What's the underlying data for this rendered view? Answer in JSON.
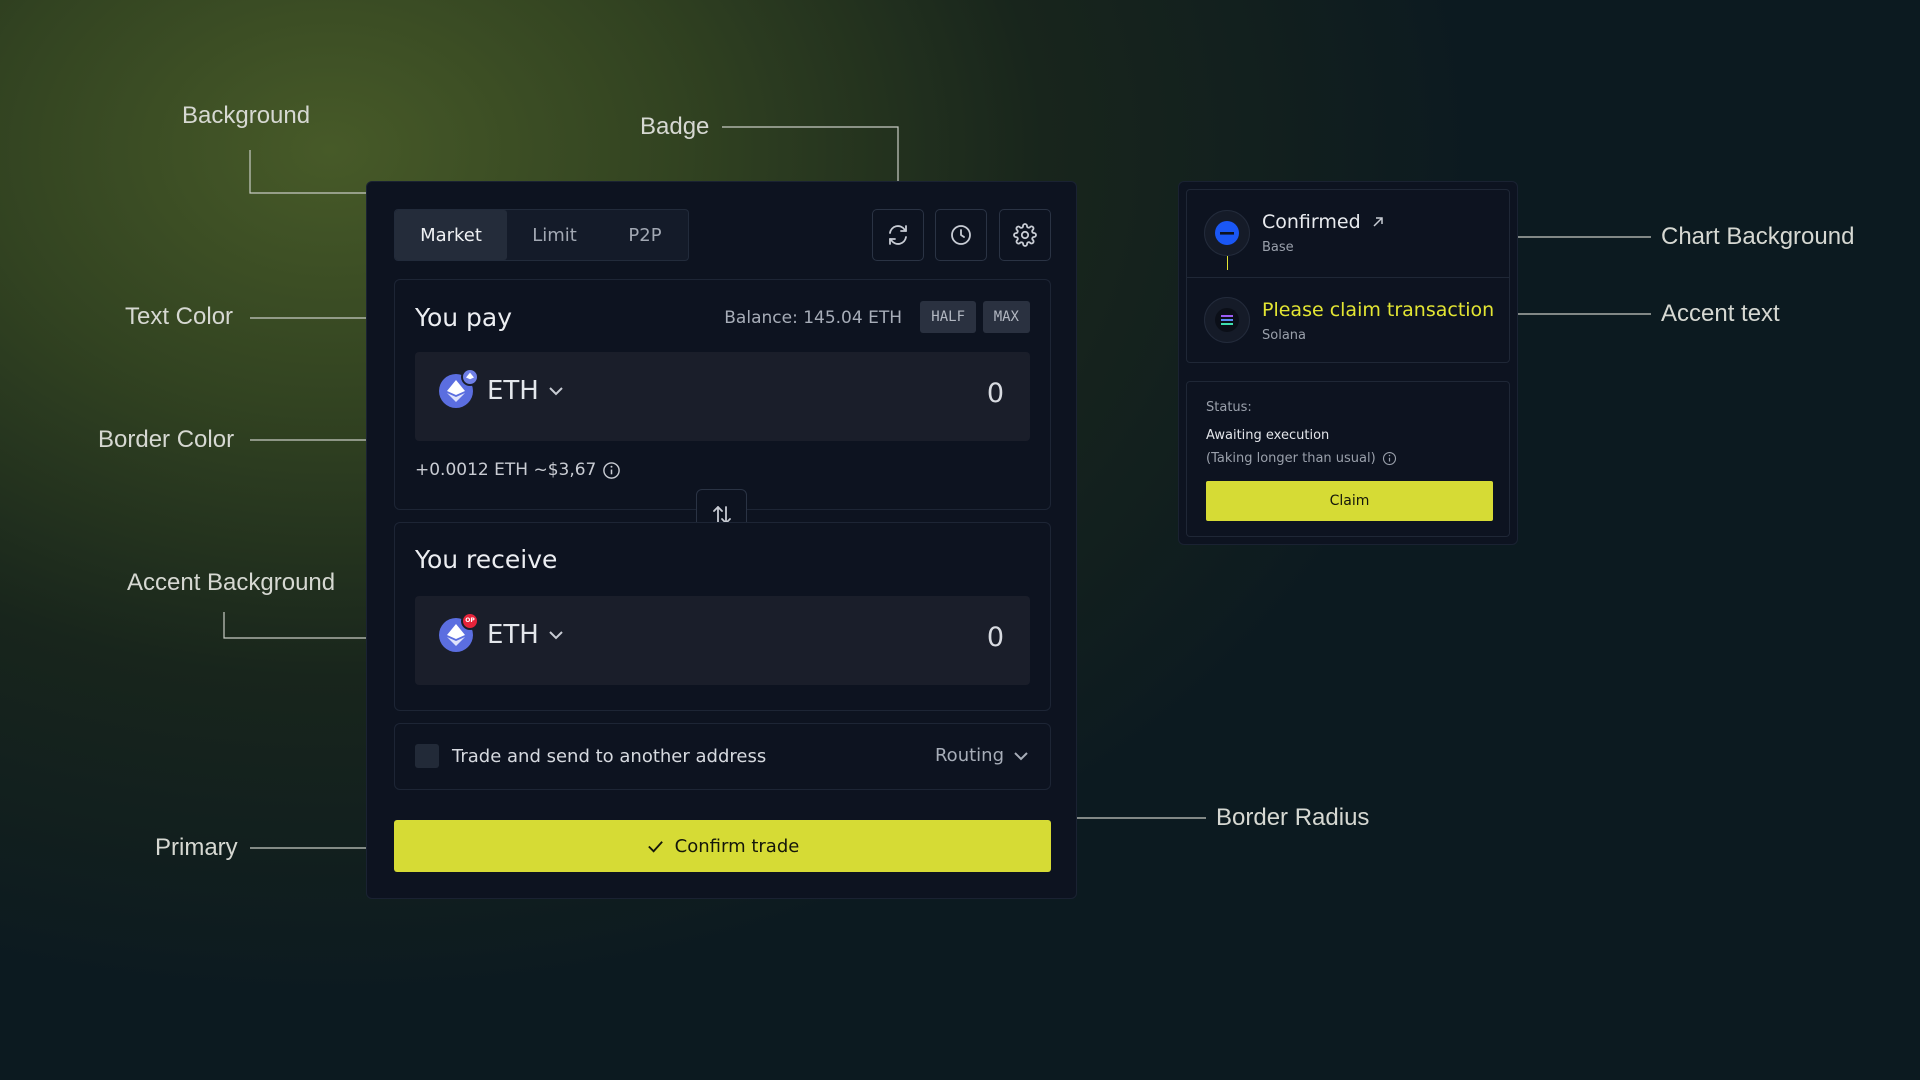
{
  "annotations": {
    "background": "Background",
    "badge": "Badge",
    "text_color": "Text Color",
    "border_color": "Border Color",
    "accent_background": "Accent Background",
    "primary": "Primary",
    "border_radius": "Border Radius",
    "chart_background": "Chart Background",
    "accent_text": "Accent text"
  },
  "colors": {
    "primary": "#d6db35",
    "card_background": "#0d1320",
    "accent_background": "#1a1e2a",
    "accent_text": "#e3e533",
    "eth_token": "#5b6ee0",
    "op_badge": "#e5233a",
    "base_chain": "#1a57f5"
  },
  "swap": {
    "tabs": [
      "Market",
      "Limit",
      "P2P"
    ],
    "active_tab": "Market",
    "toolbar_icons": [
      "refresh-icon",
      "history-icon",
      "settings-icon"
    ],
    "pay": {
      "title": "You pay",
      "balance": "Balance: 145.04 ETH",
      "half_label": "HALF",
      "max_label": "MAX",
      "token": "ETH",
      "amount": "0",
      "fee_note": "+0.0012 ETH ~$3,67"
    },
    "receive": {
      "title": "You receive",
      "token": "ETH",
      "token_badge": "OP",
      "amount": "0"
    },
    "send_option": "Trade and send to another address",
    "routing_label": "Routing",
    "confirm_label": "Confirm trade"
  },
  "status_card": {
    "confirmed": {
      "title": "Confirmed",
      "chain": "Base"
    },
    "pending": {
      "title": "Please claim transaction",
      "chain": "Solana"
    },
    "status_label": "Status:",
    "status_value": "Awaiting execution",
    "status_note": "(Taking longer than usual)",
    "claim_label": "Claim"
  }
}
